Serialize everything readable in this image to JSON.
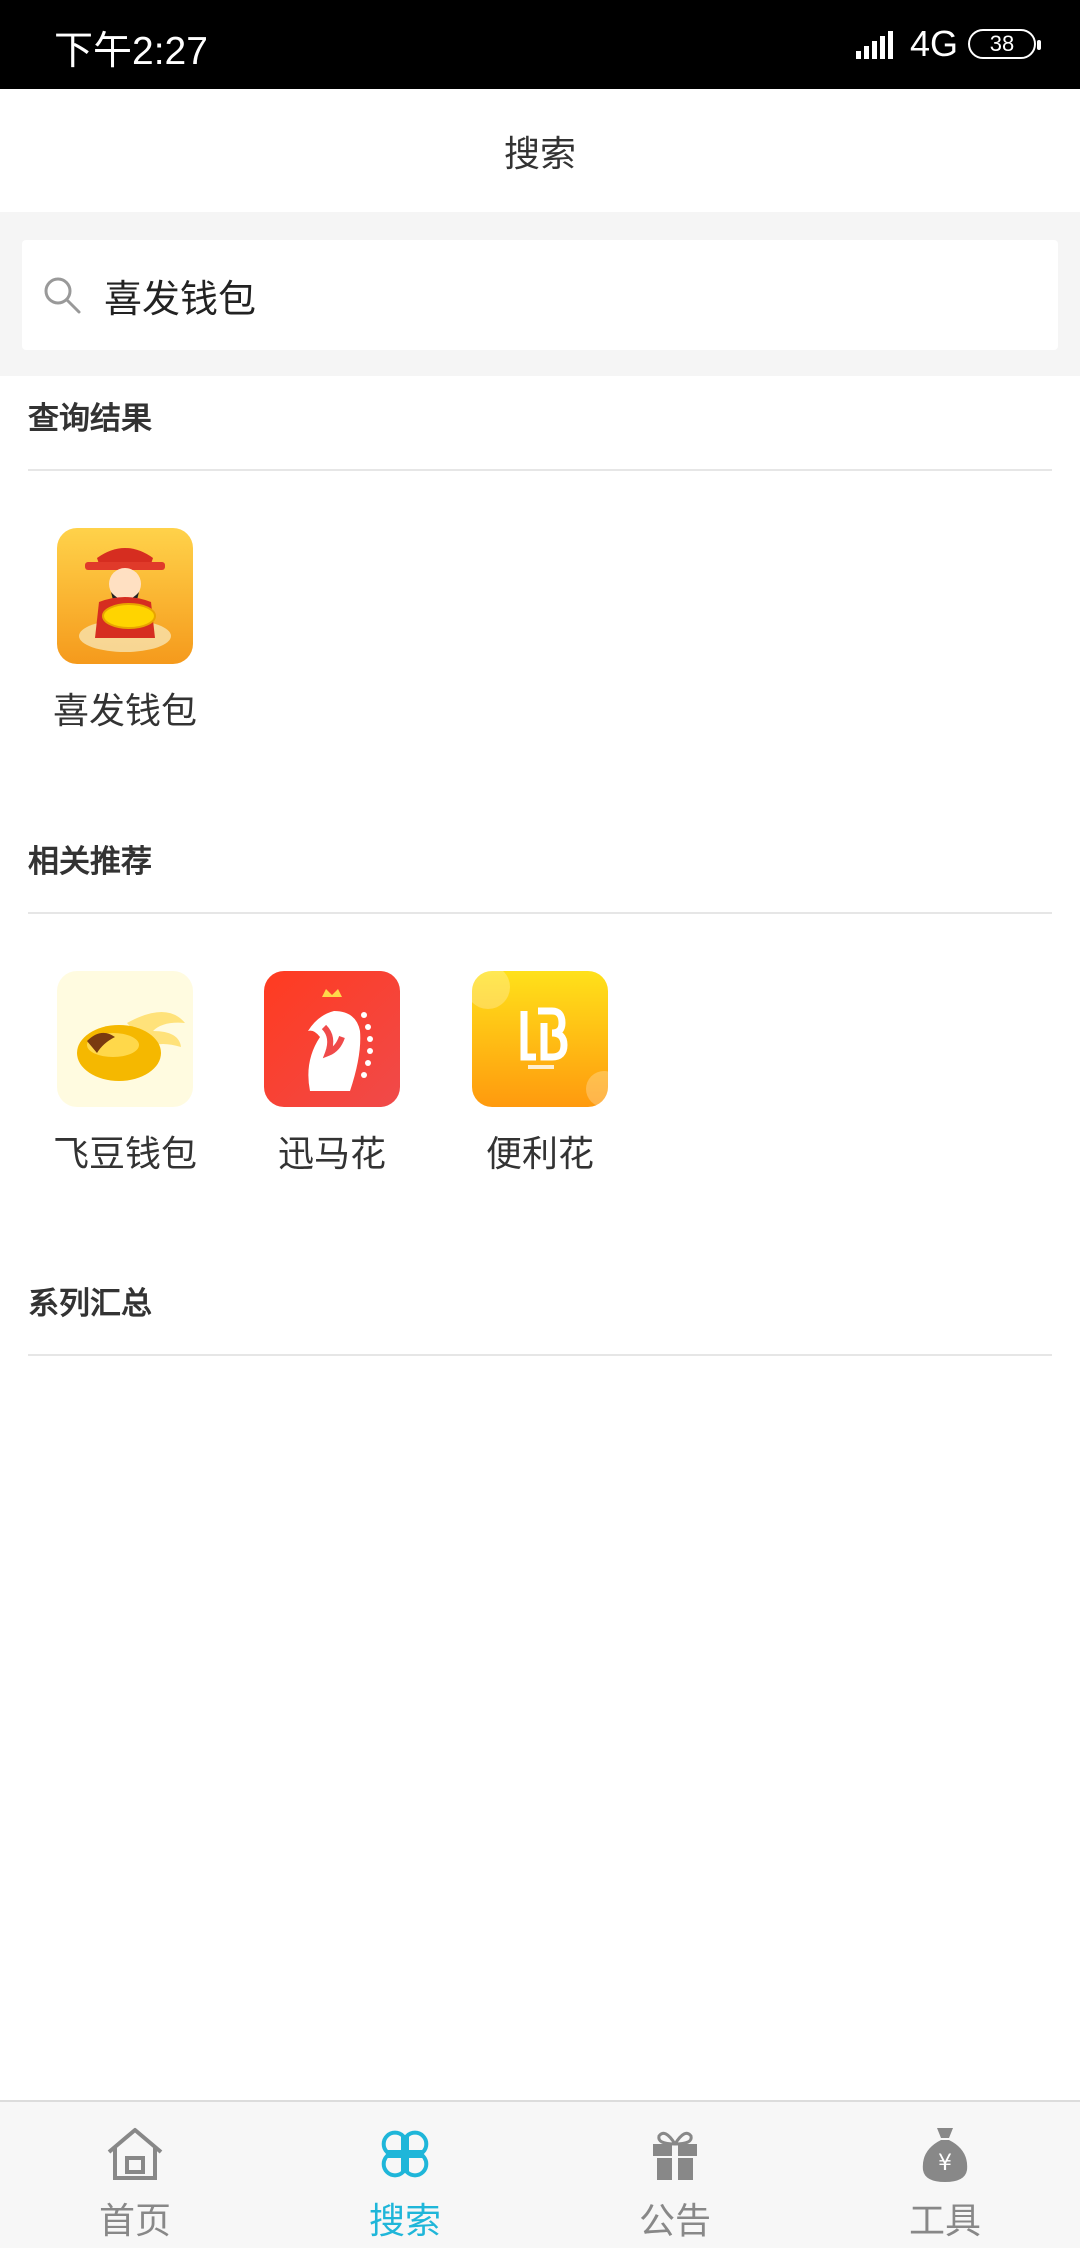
{
  "status_bar": {
    "time": "下午2:27",
    "network": "4G",
    "battery": "38"
  },
  "header": {
    "title": "搜索"
  },
  "search": {
    "value": "喜发钱包"
  },
  "sections": {
    "results": {
      "title": "查询结果",
      "apps": [
        {
          "name": "喜发钱包",
          "icon": "god-of-wealth-icon"
        }
      ]
    },
    "related": {
      "title": "相关推荐",
      "apps": [
        {
          "name": "飞豆钱包",
          "icon": "golden-bean-wings-icon"
        },
        {
          "name": "迅马花",
          "icon": "horse-crown-icon"
        },
        {
          "name": "便利花",
          "icon": "lb-logo-icon"
        }
      ]
    },
    "series": {
      "title": "系列汇总"
    }
  },
  "bottom_nav": [
    {
      "label": "首页",
      "icon": "home-icon",
      "active": false
    },
    {
      "label": "搜索",
      "icon": "clover-icon",
      "active": true
    },
    {
      "label": "公告",
      "icon": "gift-icon",
      "active": false
    },
    {
      "label": "工具",
      "icon": "money-bag-icon",
      "active": false
    }
  ],
  "colors": {
    "accent": "#1fb6d9",
    "nav_inactive": "#888888"
  }
}
